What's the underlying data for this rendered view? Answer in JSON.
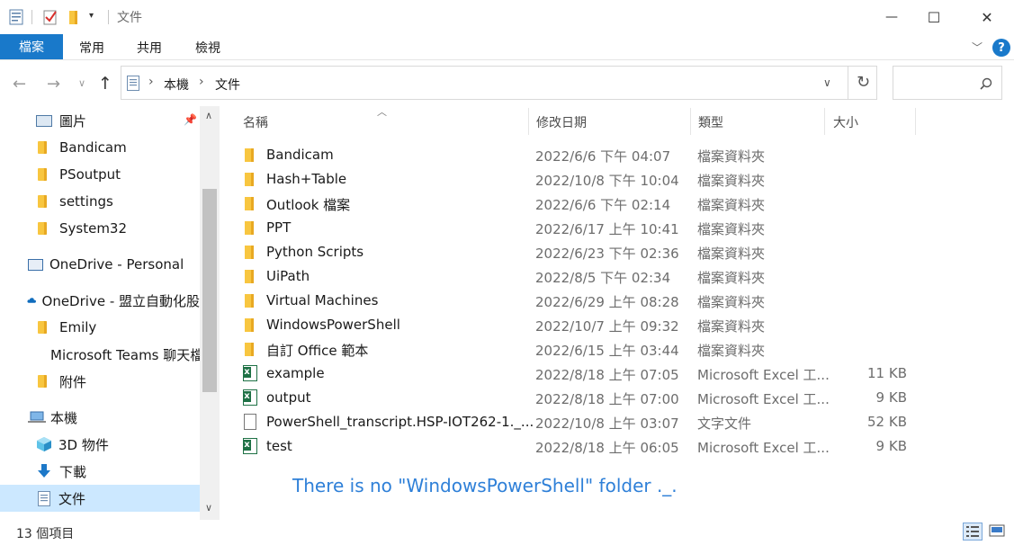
{
  "window": {
    "title": "文件",
    "minimize_glyph": "—",
    "maximize_glyph": "☐",
    "close_glyph": "✕"
  },
  "ribbon": {
    "tabs": [
      "檔案",
      "常用",
      "共用",
      "檢視"
    ],
    "help": "?"
  },
  "address": {
    "segments": [
      "本機",
      "文件"
    ],
    "separator": "›"
  },
  "nav": {
    "items": [
      {
        "label": "圖片",
        "icon": "pictures-icon",
        "pinned": true
      },
      {
        "label": "Bandicam",
        "icon": "folder-icon"
      },
      {
        "label": "PSoutput",
        "icon": "folder-icon"
      },
      {
        "label": "settings",
        "icon": "folder-icon"
      },
      {
        "label": "System32",
        "icon": "folder-icon"
      },
      {
        "label": "OneDrive - Personal",
        "icon": "onedrive-personal-icon"
      },
      {
        "label": "OneDrive - 盟立自動化股",
        "icon": "onedrive-cloud-icon"
      },
      {
        "label": "Emily",
        "icon": "folder-icon"
      },
      {
        "label": "Microsoft Teams 聊天檔",
        "icon": "folder-icon"
      },
      {
        "label": "附件",
        "icon": "folder-icon"
      },
      {
        "label": "本機",
        "icon": "this-pc-icon"
      },
      {
        "label": "3D 物件",
        "icon": "3d-objects-icon"
      },
      {
        "label": "下載",
        "icon": "downloads-icon"
      },
      {
        "label": "文件",
        "icon": "documents-icon",
        "selected": true
      }
    ]
  },
  "columns": {
    "name": "名稱",
    "date": "修改日期",
    "type": "類型",
    "size": "大小"
  },
  "files": [
    {
      "name": "Bandicam",
      "date": "2022/6/6 下午 04:07",
      "type": "檔案資料夾",
      "size": "",
      "icon": "folder"
    },
    {
      "name": "Hash+Table",
      "date": "2022/10/8 下午 10:04",
      "type": "檔案資料夾",
      "size": "",
      "icon": "folder"
    },
    {
      "name": "Outlook 檔案",
      "date": "2022/6/6 下午 02:14",
      "type": "檔案資料夾",
      "size": "",
      "icon": "folder"
    },
    {
      "name": "PPT",
      "date": "2022/6/17 上午 10:41",
      "type": "檔案資料夾",
      "size": "",
      "icon": "folder"
    },
    {
      "name": "Python Scripts",
      "date": "2022/6/23 下午 02:36",
      "type": "檔案資料夾",
      "size": "",
      "icon": "folder"
    },
    {
      "name": "UiPath",
      "date": "2022/8/5 下午 02:34",
      "type": "檔案資料夾",
      "size": "",
      "icon": "folder"
    },
    {
      "name": "Virtual Machines",
      "date": "2022/6/29 上午 08:28",
      "type": "檔案資料夾",
      "size": "",
      "icon": "folder"
    },
    {
      "name": "WindowsPowerShell",
      "date": "2022/10/7 上午 09:32",
      "type": "檔案資料夾",
      "size": "",
      "icon": "folder"
    },
    {
      "name": "自訂 Office 範本",
      "date": "2022/6/15 上午 03:44",
      "type": "檔案資料夾",
      "size": "",
      "icon": "folder"
    },
    {
      "name": "example",
      "date": "2022/8/18 上午 07:05",
      "type": "Microsoft Excel 工...",
      "size": "11 KB",
      "icon": "excel"
    },
    {
      "name": "output",
      "date": "2022/8/18 上午 07:00",
      "type": "Microsoft Excel 工...",
      "size": "9 KB",
      "icon": "excel"
    },
    {
      "name": "PowerShell_transcript.HSP-IOT262-1._...",
      "date": "2022/10/8 上午 03:07",
      "type": "文字文件",
      "size": "52 KB",
      "icon": "text"
    },
    {
      "name": "test",
      "date": "2022/8/18 上午 06:05",
      "type": "Microsoft Excel 工...",
      "size": "9 KB",
      "icon": "excel"
    }
  ],
  "annotation": "There is no \"WindowsPowerShell\" folder ._.",
  "status": {
    "item_count": "13 個項目"
  },
  "colors": {
    "accent": "#1979ca",
    "annotation": "#2f80d8",
    "selected_bg": "#cce8ff",
    "folder": "#f8c640"
  }
}
